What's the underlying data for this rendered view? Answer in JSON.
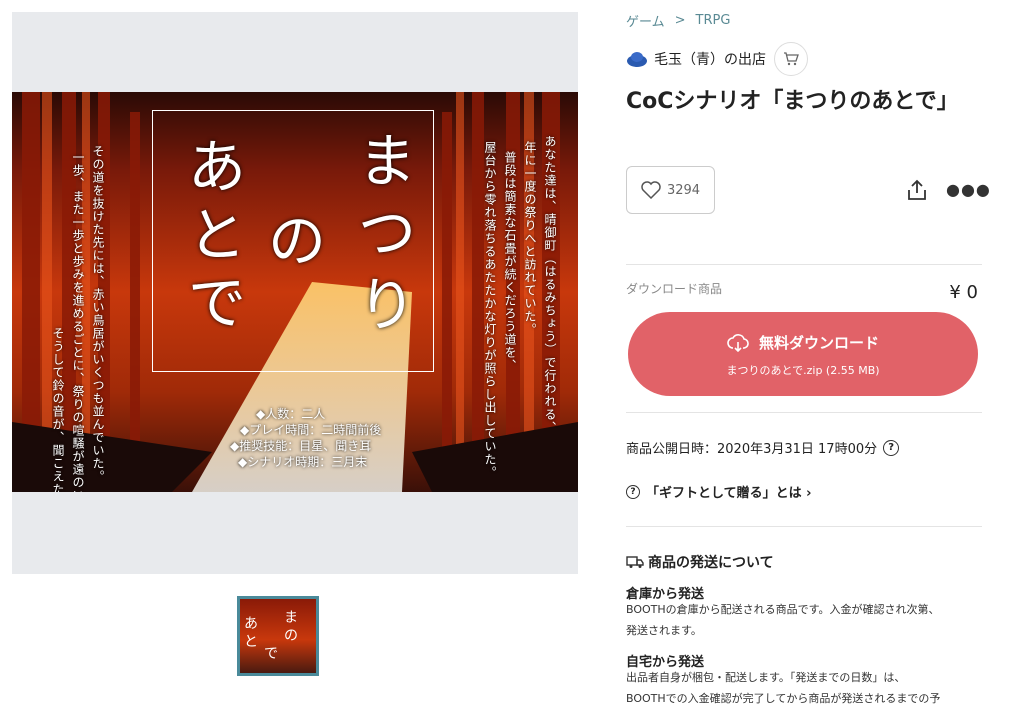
{
  "breadcrumb": [
    "ゲーム",
    "TRPG"
  ],
  "shop": {
    "name": "毛玉（青）の出店",
    "icon": "cart-icon"
  },
  "product": {
    "title": "CoCシナリオ「まつりのあとで」"
  },
  "likes": {
    "count": "3294",
    "icon": "heart-icon"
  },
  "purchase": {
    "type_label": "ダウンロード商品",
    "price": "¥ 0",
    "download_label": "無料ダウンロード",
    "file_label": "まつりのあとで.zip (2.55 MB)"
  },
  "info": {
    "published": "商品公開日時：2020年3月31日 17時00分",
    "gift": "「ギフトとして贈る」とは ›"
  },
  "shipping": {
    "heading": "商品の発送について",
    "warehouse_title": "倉庫から発送",
    "warehouse_desc_1": "BOOTHの倉庫から配送される商品です。入金が確認され次第、",
    "warehouse_desc_2": "発送されます。",
    "home_title": "自宅から発送",
    "home_desc_1": "出品者自身が梱包・配送します。「発送までの日数」は、",
    "home_desc_2": "BOOTHでの入金確認が完了してから商品が発送されるまでの予"
  },
  "cover": {
    "title_chars": [
      "ま",
      "つ",
      "り",
      "の",
      "あ",
      "と",
      "で"
    ],
    "left_col_1": "その道を抜けた先には、赤い鳥居がいくつも並んでいた。",
    "left_col_2": "一歩、また一歩と歩みを進めるごとに、祭りの喧騒が遠のいていく。",
    "left_col_3": "そうして鈴の音が、聞こえた。",
    "right_col_1": "あなた達は、晴御町（はるみちょう）で行われる、",
    "right_col_2": "年に一度の祭りへと訪れていた。",
    "right_col_3": "普段は簡素な石畳が続くだろう道を、",
    "right_col_4": "屋台から零れ落ちるあたたかな灯りが照らし出していた。",
    "specs": [
      "◆人数：二人",
      "◆プレイ時間：二時間前後",
      "◆推奨技能：目星、聞き耳",
      "◆シナリオ時期：三月末"
    ]
  },
  "thumb": {
    "chars": [
      "ま",
      "の",
      "あ",
      "と",
      "で"
    ]
  },
  "colors": {
    "accent": "#e16268",
    "link": "#5a8a94"
  }
}
